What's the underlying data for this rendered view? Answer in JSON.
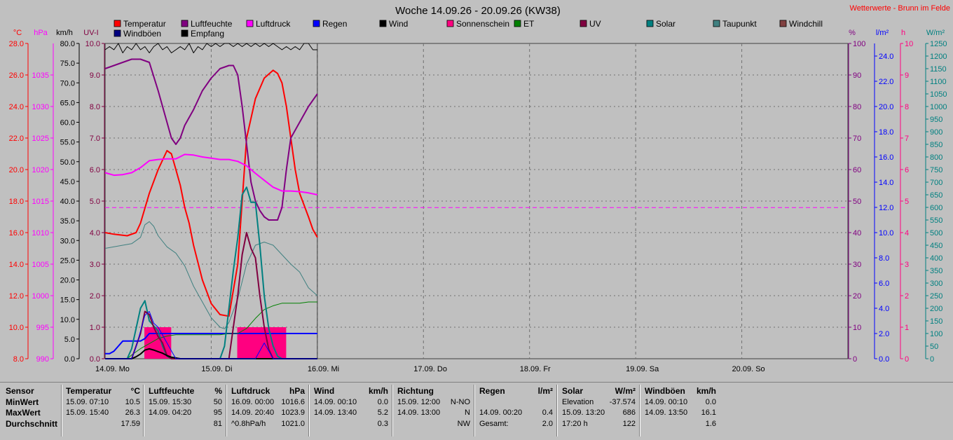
{
  "title": "Woche 14.09.26 - 20.09.26 (KW38)",
  "source_label": "Wetterwerte - Brunn im Felde",
  "legend": [
    {
      "label": "Temperatur",
      "color": "#ff0000"
    },
    {
      "label": "Luftfeuchte",
      "color": "#800080"
    },
    {
      "label": "Luftdruck",
      "color": "#ff00ff"
    },
    {
      "label": "Regen",
      "color": "#0000ff"
    },
    {
      "label": "Wind",
      "color": "#000000"
    },
    {
      "label": "Sonnenschein",
      "color": "#ff0080"
    },
    {
      "label": "ET",
      "color": "#008000"
    },
    {
      "label": "UV",
      "color": "#800040"
    },
    {
      "label": "Solar",
      "color": "#008080"
    },
    {
      "label": "Taupunkt",
      "color": "#408080"
    },
    {
      "label": "Windchill",
      "color": "#804040"
    },
    {
      "label": "Windböen",
      "color": "#000080"
    },
    {
      "label": "Empfang",
      "color": "#000000"
    }
  ],
  "axes": {
    "temp": {
      "label": "°C",
      "color": "#ff0000",
      "ticks": [
        "8.0",
        "10.0",
        "12.0",
        "14.0",
        "16.0",
        "18.0",
        "20.0",
        "22.0",
        "24.0",
        "26.0",
        "28.0"
      ]
    },
    "press": {
      "label": "hPa",
      "color": "#ff00ff",
      "ticks": [
        "990",
        "995",
        "1000",
        "1005",
        "1010",
        "1015",
        "1020",
        "1025",
        "1030",
        "1035"
      ]
    },
    "wind": {
      "label": "km/h",
      "color": "#000000",
      "ticks": [
        "0.0",
        "5.0",
        "10.0",
        "15.0",
        "20.0",
        "25.0",
        "30.0",
        "35.0",
        "40.0",
        "45.0",
        "50.0",
        "55.0",
        "60.0",
        "65.0",
        "70.0",
        "75.0",
        "80.0"
      ]
    },
    "uv": {
      "label": "UV-I",
      "color": "#800040",
      "ticks": [
        "0.0",
        "1.0",
        "2.0",
        "3.0",
        "4.0",
        "5.0",
        "6.0",
        "7.0",
        "8.0",
        "9.0",
        "10.0"
      ]
    },
    "hum": {
      "label": "%",
      "color": "#800080",
      "ticks": [
        "0",
        "10",
        "20",
        "30",
        "40",
        "50",
        "60",
        "70",
        "80",
        "90",
        "100"
      ]
    },
    "rain": {
      "label": "l/m²",
      "color": "#0000ff",
      "ticks": [
        "0.0",
        "2.0",
        "4.0",
        "6.0",
        "8.0",
        "10.0",
        "12.0",
        "14.0",
        "16.0",
        "18.0",
        "20.0",
        "22.0",
        "24.0"
      ]
    },
    "sun": {
      "label": "h",
      "color": "#ff0080",
      "ticks": [
        "0",
        "1",
        "2",
        "3",
        "4",
        "5",
        "6",
        "7",
        "8",
        "9",
        "10"
      ]
    },
    "solar": {
      "label": "W/m²",
      "color": "#008080",
      "ticks": [
        "0",
        "50",
        "100",
        "150",
        "200",
        "250",
        "300",
        "350",
        "400",
        "450",
        "500",
        "550",
        "600",
        "650",
        "700",
        "750",
        "800",
        "850",
        "900",
        "950",
        "1000",
        "1050",
        "1100",
        "1150",
        "1200",
        "1250"
      ]
    }
  },
  "day_labels": [
    "14.09. Mo",
    "15.09. Di",
    "16.09. Mi",
    "17.09. Do",
    "18.09. Fr",
    "19.09. Sa",
    "20.09. So"
  ],
  "chart_data": {
    "type": "line",
    "title": "Woche 14.09.26 - 20.09.26 (KW38)",
    "x_unit": "hours since 14.09. 00:00",
    "xlim": [
      0,
      168
    ],
    "series": [
      {
        "name": "Temperatur",
        "unit": "°C",
        "color": "#ff0000",
        "width": 2,
        "x": [
          0,
          2,
          5,
          7,
          8,
          10,
          12,
          14,
          15,
          16,
          17,
          18,
          19,
          20,
          22,
          24,
          26,
          28,
          30,
          31,
          32,
          34,
          36,
          38,
          39,
          40,
          41,
          42,
          43,
          44,
          46,
          47,
          48
        ],
        "y": [
          16.0,
          15.9,
          15.8,
          16.0,
          16.6,
          18.5,
          20.0,
          21.2,
          21.0,
          20.0,
          19.0,
          17.6,
          16.6,
          15.2,
          13.0,
          11.5,
          10.8,
          10.7,
          14.0,
          18.0,
          22.0,
          24.5,
          25.8,
          26.3,
          26.1,
          25.5,
          24.0,
          22.0,
          20.0,
          18.5,
          17.0,
          16.2,
          15.7
        ]
      },
      {
        "name": "Luftfeuchte",
        "unit": "%",
        "color": "#800080",
        "width": 2,
        "x": [
          0,
          2,
          4,
          6,
          8,
          10,
          12,
          13,
          14,
          15,
          16,
          17,
          18,
          20,
          22,
          24,
          26,
          28,
          29,
          30,
          31,
          32,
          33,
          34,
          35,
          36,
          37,
          38,
          39,
          40,
          41,
          42,
          44,
          46,
          48
        ],
        "y": [
          92,
          93,
          94,
          95,
          95,
          94,
          85,
          80,
          75,
          70,
          68,
          70,
          74,
          79,
          85,
          89,
          92,
          93,
          93,
          90,
          80,
          68,
          56,
          50,
          47,
          45,
          44,
          44,
          44,
          48,
          60,
          70,
          75,
          80,
          84
        ]
      },
      {
        "name": "Luftdruck",
        "unit": "hPa",
        "color": "#ff00ff",
        "width": 2,
        "x": [
          0,
          2,
          4,
          6,
          8,
          10,
          12,
          14,
          16,
          18,
          20,
          22,
          24,
          26,
          28,
          30,
          32,
          34,
          36,
          38,
          40,
          42,
          44,
          46,
          48
        ],
        "y": [
          1019.5,
          1019.1,
          1019.2,
          1019.5,
          1020.3,
          1021.4,
          1021.6,
          1021.7,
          1021.7,
          1022.4,
          1022.3,
          1022.0,
          1021.8,
          1021.6,
          1021.6,
          1021.3,
          1020.6,
          1019.4,
          1018.3,
          1017.2,
          1016.6,
          1016.6,
          1016.5,
          1016.3,
          1016.0
        ]
      },
      {
        "name": "Regen",
        "unit": "l/m²",
        "color": "#0000ff",
        "width": 2,
        "x": [
          0,
          1,
          2,
          3,
          4,
          5,
          6,
          7,
          8,
          9,
          10,
          11,
          12,
          48
        ],
        "y": [
          0.4,
          0.4,
          0.6,
          1.0,
          1.4,
          1.4,
          1.4,
          1.4,
          1.4,
          1.6,
          2.0,
          2.0,
          2.0,
          2.0
        ]
      },
      {
        "name": "Taupunkt",
        "unit": "°C",
        "color": "#408080",
        "width": 1,
        "x": [
          0,
          2,
          4,
          6,
          8,
          9,
          10,
          11,
          12,
          14,
          16,
          18,
          20,
          22,
          24,
          26,
          27,
          28,
          30,
          32,
          34,
          36,
          38,
          40,
          42,
          44,
          46,
          48
        ],
        "y": [
          15.0,
          15.1,
          15.2,
          15.3,
          15.7,
          16.5,
          16.7,
          16.4,
          15.8,
          15.1,
          14.7,
          13.9,
          12.6,
          11.6,
          10.6,
          10.0,
          9.9,
          10.3,
          11.8,
          14.0,
          15.2,
          15.4,
          15.2,
          14.6,
          14.0,
          13.5,
          12.5,
          12.0
        ]
      },
      {
        "name": "ET",
        "unit": "l/m²",
        "color": "#008000",
        "width": 1,
        "x": [
          0,
          5,
          6,
          8,
          10,
          12,
          14,
          16,
          18,
          20,
          22,
          24,
          26,
          28,
          30,
          32,
          34,
          36,
          38,
          40,
          42,
          44,
          46,
          48
        ],
        "y": [
          0.0,
          0.0,
          0.3,
          0.8,
          1.2,
          1.6,
          1.8,
          1.9,
          1.9,
          1.9,
          1.9,
          1.9,
          1.9,
          2.0,
          2.0,
          2.4,
          3.2,
          3.9,
          4.2,
          4.4,
          4.4,
          4.4,
          4.5,
          4.5
        ]
      },
      {
        "name": "Solar",
        "unit": "W/m²",
        "color": "#008080",
        "width": 2,
        "x": [
          0,
          5,
          6,
          7,
          8,
          9,
          10,
          11,
          12,
          13,
          14,
          15,
          16,
          17,
          18,
          26,
          27,
          28,
          29,
          30,
          31,
          32,
          33,
          34,
          35,
          36,
          37,
          38,
          39,
          40,
          41,
          42,
          48
        ],
        "y": [
          0,
          0,
          40,
          120,
          200,
          230,
          150,
          130,
          110,
          50,
          10,
          0,
          0,
          0,
          0,
          0,
          50,
          200,
          350,
          480,
          650,
          680,
          620,
          620,
          450,
          250,
          120,
          50,
          10,
          0,
          0,
          0,
          0
        ]
      },
      {
        "name": "UV",
        "unit": "UV-I",
        "color": "#800040",
        "width": 2,
        "x": [
          0,
          6,
          8,
          9,
          10,
          11,
          12,
          13,
          14,
          15,
          26,
          28,
          29,
          30,
          31,
          32,
          33,
          34,
          35,
          36,
          37,
          38,
          48
        ],
        "y": [
          0,
          0,
          0.8,
          1.5,
          1.4,
          1.0,
          0.7,
          0.5,
          0.1,
          0,
          0,
          0,
          1.0,
          2.0,
          3.3,
          4.0,
          3.5,
          3.2,
          2.0,
          1.0,
          0.3,
          0,
          0
        ]
      },
      {
        "name": "Wind",
        "unit": "km/h",
        "color": "#000000",
        "width": 2,
        "x": [
          0,
          6,
          7,
          8,
          9,
          10,
          11,
          12,
          13,
          14,
          15,
          16,
          17,
          18,
          20,
          48
        ],
        "y": [
          0,
          0,
          0.5,
          1.2,
          2.2,
          2.5,
          2.2,
          1.8,
          1.4,
          0.8,
          0.4,
          0.2,
          0,
          0,
          0,
          0
        ]
      },
      {
        "name": "Windböen",
        "unit": "km/h",
        "color": "#0000ff",
        "width": 1,
        "x": [
          0,
          6,
          7,
          8,
          9,
          10,
          11,
          12,
          13,
          14,
          15,
          16,
          17,
          32,
          33,
          34,
          35,
          36,
          37,
          38,
          39,
          40,
          48
        ],
        "y": [
          0,
          0,
          3,
          7,
          11,
          12,
          9,
          8,
          6,
          4,
          2,
          0,
          0,
          0,
          0,
          0,
          2,
          4,
          2,
          0,
          0,
          0,
          0
        ]
      },
      {
        "name": "Empfang",
        "unit": "%",
        "color": "#000000",
        "width": 1,
        "x": [
          0,
          1,
          2,
          3,
          4,
          5,
          6,
          7,
          8,
          9,
          10,
          11,
          12,
          13,
          14,
          15,
          16,
          17,
          18,
          19,
          20,
          21,
          22,
          23,
          24,
          25,
          26,
          27,
          28,
          29,
          30,
          31,
          32,
          33,
          34,
          35,
          36,
          37,
          38,
          39,
          40,
          41,
          42,
          43,
          44,
          45,
          46,
          47,
          48
        ],
        "y": [
          98,
          99,
          98,
          100,
          97,
          99,
          98,
          100,
          98,
          99,
          97,
          99,
          100,
          98,
          99,
          97,
          98,
          99,
          98,
          100,
          97,
          99,
          98,
          100,
          99,
          100,
          99,
          100,
          100,
          99,
          100,
          99,
          100,
          99,
          100,
          99,
          100,
          99,
          100,
          99,
          98,
          99,
          98,
          99,
          98,
          100,
          100,
          98,
          98
        ]
      }
    ],
    "sunshine_hours": [
      9,
      10,
      11,
      12,
      13,
      14,
      30,
      31,
      32,
      33,
      34,
      35,
      36,
      37,
      38,
      39,
      40
    ],
    "reference_line": {
      "temp": 17.59,
      "color": "#ff00ff"
    }
  },
  "stats": {
    "sensor": {
      "header": "Sensor",
      "rows": [
        "MinWert",
        "MaxWert",
        "Durchschnitt"
      ]
    },
    "temperature": {
      "header": "Temperatur",
      "unit": "°C",
      "rows": [
        [
          "15.09.  07:10",
          "10.5"
        ],
        [
          "15.09.  15:40",
          "26.3"
        ],
        [
          "",
          "17.59"
        ]
      ]
    },
    "humidity": {
      "header": "Luftfeuchte",
      "unit": "%",
      "rows": [
        [
          "15.09.  15:30",
          "50"
        ],
        [
          "14.09.  04:20",
          "95"
        ],
        [
          "",
          "81"
        ]
      ]
    },
    "pressure": {
      "header": "Luftdruck",
      "unit": "hPa",
      "rows": [
        [
          "16.09.  00:00",
          "1016.6"
        ],
        [
          "14.09.  20:40",
          "1023.9"
        ],
        [
          "^0.8hPa/h",
          "1021.0"
        ]
      ]
    },
    "wind": {
      "header": "Wind",
      "unit": "km/h",
      "rows": [
        [
          "14.09.  00:10",
          "0.0"
        ],
        [
          "14.09.  13:40",
          "5.2"
        ],
        [
          "",
          "0.3"
        ]
      ]
    },
    "direction": {
      "header": "Richtung",
      "rows": [
        [
          "15.09.  12:00",
          "N-NO"
        ],
        [
          "14.09.  13:00",
          "N"
        ],
        [
          "",
          "NW"
        ]
      ]
    },
    "rain": {
      "header": "Regen",
      "unit": "l/m²",
      "rows": [
        [
          "",
          ""
        ],
        [
          "14.09.  00:20",
          "0.4"
        ],
        [
          "Gesamt:",
          "2.0"
        ]
      ]
    },
    "solar": {
      "header": "Solar",
      "unit": "W/m²",
      "rows": [
        [
          "Elevation",
          "-37.574"
        ],
        [
          "15.09.  13:20",
          "686"
        ],
        [
          "17:20 h",
          "122"
        ]
      ]
    },
    "gusts": {
      "header": "Windböen",
      "unit": "km/h",
      "rows": [
        [
          "14.09.  00:10",
          "0.0"
        ],
        [
          "14.09.  13:50",
          "16.1"
        ],
        [
          "",
          "1.6"
        ]
      ]
    }
  }
}
